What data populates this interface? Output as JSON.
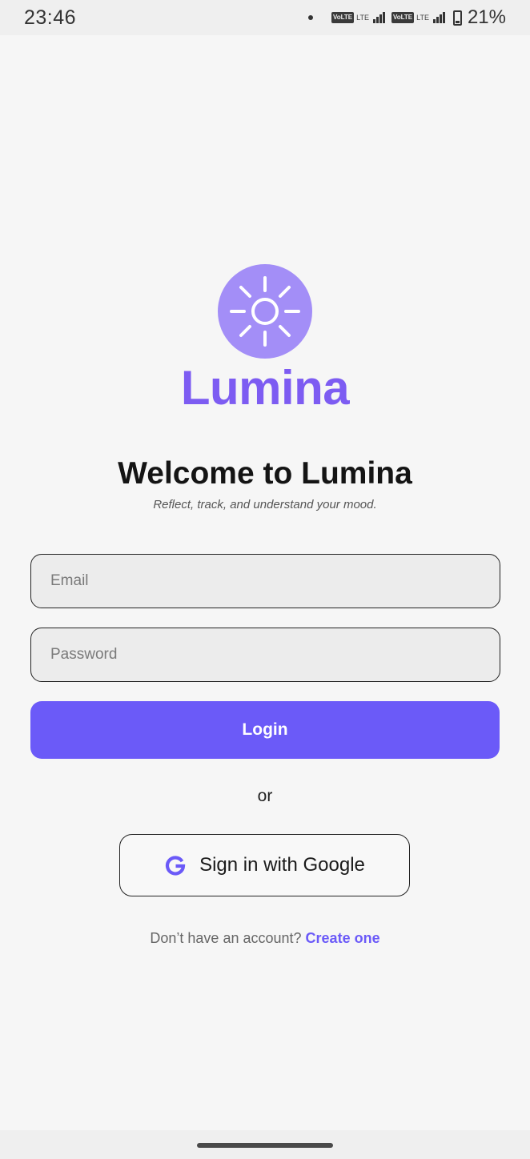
{
  "status_bar": {
    "time": "23:46",
    "volte_1": "VoLTE",
    "lte_1": "LTE",
    "volte_2": "VoLTE",
    "lte_2": "LTE",
    "battery": "21%"
  },
  "brand": {
    "name": "Lumina",
    "logo_icon": "sun-icon",
    "accent_color": "#6b5af8",
    "logo_color": "#a38ef7"
  },
  "welcome": {
    "title": "Welcome to Lumina",
    "subtitle": "Reflect, track, and understand your mood."
  },
  "form": {
    "email_placeholder": "Email",
    "password_placeholder": "Password",
    "login_label": "Login"
  },
  "divider": "or",
  "google": {
    "label": "Sign in with Google",
    "icon": "google-icon"
  },
  "signup": {
    "prompt": "Don’t have an account?",
    "link": "Create one"
  }
}
